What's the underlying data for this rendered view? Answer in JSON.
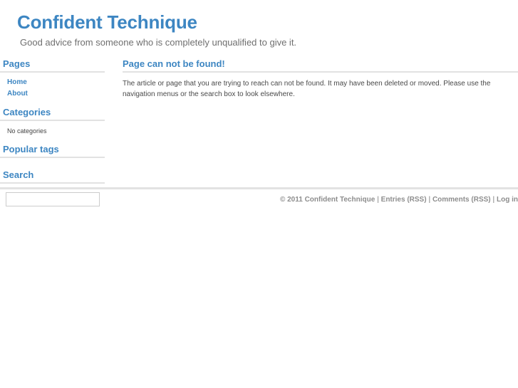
{
  "header": {
    "title": "Confident Technique",
    "tagline": "Good advice from someone who is completely unqualified to give it.",
    "title_color": "#3d86c2",
    "tagline_color": "#6f6f6f"
  },
  "sidebar": {
    "widgets": [
      {
        "title": "Pages",
        "links": [
          {
            "label": "Home"
          },
          {
            "label": "About"
          }
        ]
      },
      {
        "title": "Categories",
        "empty_note": "No categories"
      },
      {
        "title": "Popular tags"
      },
      {
        "title": "Search",
        "input_value": "",
        "input_placeholder": ""
      }
    ]
  },
  "main": {
    "entry_title": "Page can not be found!",
    "entry_body": "The article or page that you are trying to reach can not be found. It may have been deleted or moved. Please use the navigation menus or the search box to look elsewhere."
  },
  "footer": {
    "copyright": "© 2011 Confident Technique",
    "sep": "|",
    "entries_rss": "Entries (RSS)",
    "comments_rss": "Comments (RSS)",
    "login": "Log in",
    "text_color": "#8d8d8d"
  }
}
